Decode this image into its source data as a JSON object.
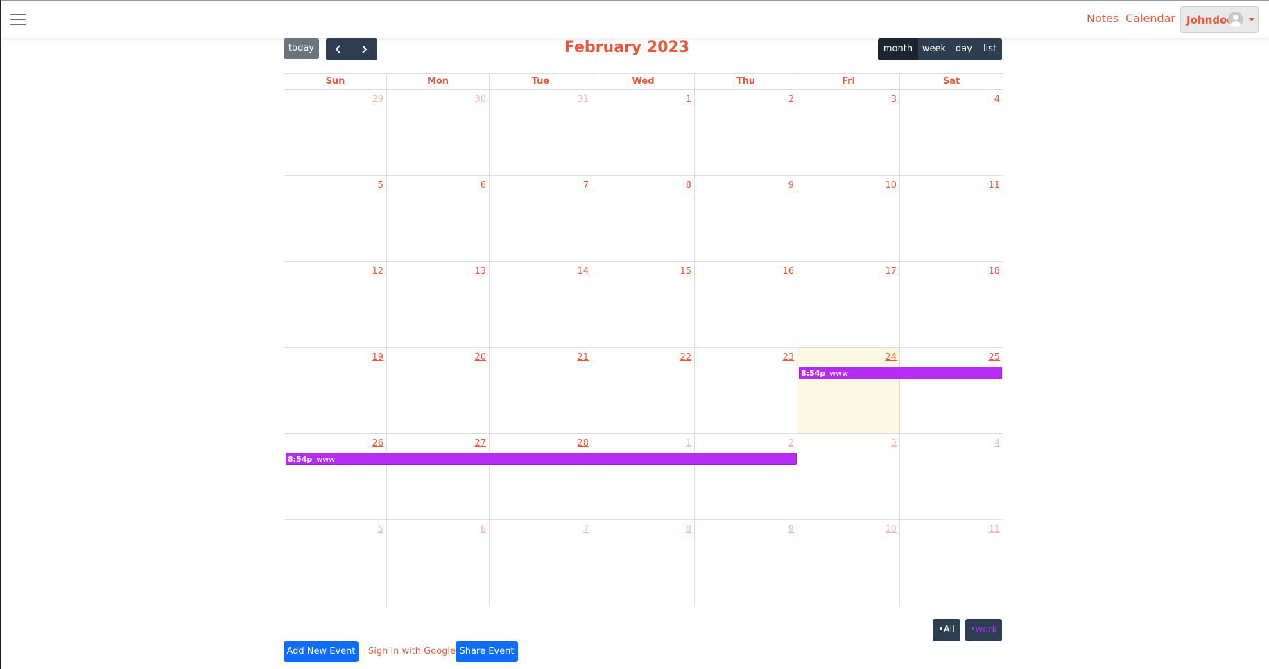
{
  "nav": {
    "notes": "Notes",
    "calendar": "Calendar",
    "user": "Johndoe"
  },
  "toolbar": {
    "today": "today",
    "title": "February 2023",
    "views": [
      "month",
      "week",
      "day",
      "list"
    ],
    "active_view": "month"
  },
  "days": [
    "Sun",
    "Mon",
    "Tue",
    "Wed",
    "Thu",
    "Fri",
    "Sat"
  ],
  "weeks": [
    [
      {
        "d": "29",
        "o": true
      },
      {
        "d": "30",
        "o": true
      },
      {
        "d": "31",
        "o": true
      },
      {
        "d": "1"
      },
      {
        "d": "2"
      },
      {
        "d": "3"
      },
      {
        "d": "4"
      }
    ],
    [
      {
        "d": "5"
      },
      {
        "d": "6"
      },
      {
        "d": "7"
      },
      {
        "d": "8"
      },
      {
        "d": "9"
      },
      {
        "d": "10"
      },
      {
        "d": "11"
      }
    ],
    [
      {
        "d": "12"
      },
      {
        "d": "13"
      },
      {
        "d": "14"
      },
      {
        "d": "15"
      },
      {
        "d": "16"
      },
      {
        "d": "17"
      },
      {
        "d": "18"
      }
    ],
    [
      {
        "d": "19"
      },
      {
        "d": "20"
      },
      {
        "d": "21"
      },
      {
        "d": "22"
      },
      {
        "d": "23"
      },
      {
        "d": "24",
        "today": true
      },
      {
        "d": "25"
      }
    ],
    [
      {
        "d": "26"
      },
      {
        "d": "27"
      },
      {
        "d": "28"
      },
      {
        "d": "1",
        "o": true
      },
      {
        "d": "2",
        "o": true
      },
      {
        "d": "3",
        "o": true
      },
      {
        "d": "4",
        "o": true
      }
    ],
    [
      {
        "d": "5",
        "o": true
      },
      {
        "d": "6",
        "o": true
      },
      {
        "d": "7",
        "o": true
      },
      {
        "d": "8",
        "o": true
      },
      {
        "d": "9",
        "o": true
      },
      {
        "d": "10",
        "o": true
      },
      {
        "d": "11",
        "o": true
      }
    ]
  ],
  "events": [
    {
      "time": "8:54p",
      "title": "www",
      "color": "#b42df4"
    },
    {
      "time": "8:54p",
      "title": "www",
      "color": "#b42df4"
    }
  ],
  "filters": {
    "all": "•All",
    "work": "•work"
  },
  "actions": {
    "add": "Add New Event",
    "google": "Sign in with Google",
    "share": "Share Event"
  },
  "colors": {
    "accent": "#e8593c",
    "dark": "#2c3e50",
    "primary": "#0d6efd",
    "event": "#b42df4",
    "today": "#fcf8e3"
  }
}
